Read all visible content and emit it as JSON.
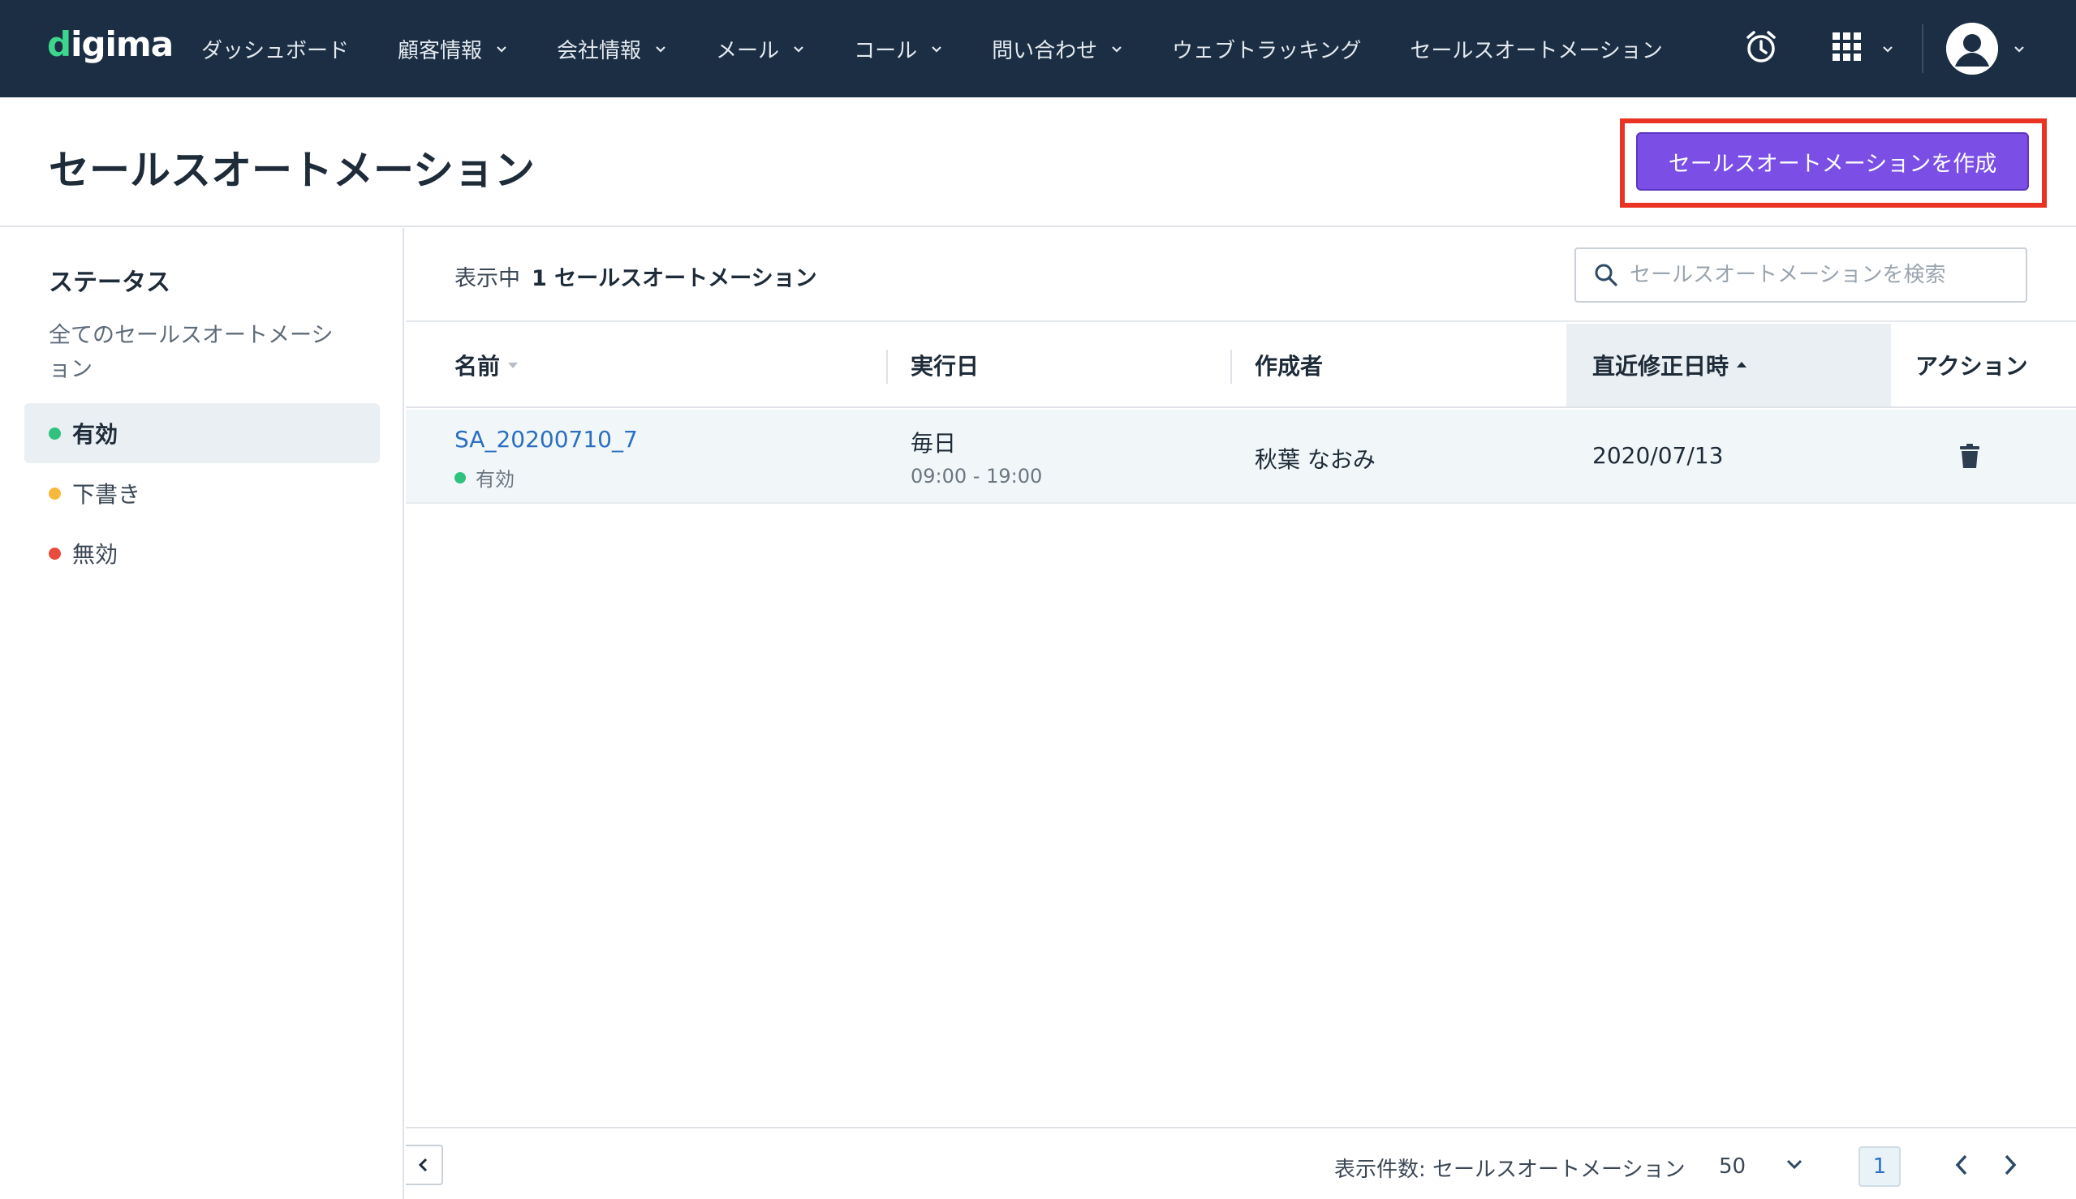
{
  "brand": {
    "logo_text": "igima",
    "logo_mark": "d"
  },
  "nav": {
    "items": [
      {
        "label": "ダッシュボード",
        "has_dropdown": false
      },
      {
        "label": "顧客情報",
        "has_dropdown": true
      },
      {
        "label": "会社情報",
        "has_dropdown": true
      },
      {
        "label": "メール",
        "has_dropdown": true
      },
      {
        "label": "コール",
        "has_dropdown": true
      },
      {
        "label": "問い合わせ",
        "has_dropdown": true
      },
      {
        "label": "ウェブトラッキング",
        "has_dropdown": false
      },
      {
        "label": "セールスオートメーション",
        "has_dropdown": false
      }
    ],
    "icons": [
      "alarm-clock-icon",
      "apps-grid-icon",
      "user-avatar-icon"
    ]
  },
  "page": {
    "title": "セールスオートメーション",
    "create_button": "セールスオートメーションを作成"
  },
  "sidebar": {
    "title": "ステータス",
    "all_label": "全てのセールスオートメーション",
    "items": [
      {
        "label": "有効",
        "color": "#2ec27e",
        "active": true
      },
      {
        "label": "下書き",
        "color": "#f6b93b",
        "active": false
      },
      {
        "label": "無効",
        "color": "#e74c3c",
        "active": false
      }
    ]
  },
  "main": {
    "count_prefix": "表示中",
    "count_text": "1 セールスオートメーション",
    "search_placeholder": "セールスオートメーションを検索",
    "columns": {
      "name": "名前",
      "exec": "実行日",
      "author": "作成者",
      "modified": "直近修正日時",
      "action": "アクション"
    },
    "rows": [
      {
        "name": "SA_20200710_7",
        "status": "有効",
        "status_color": "#2ec27e",
        "exec_day": "毎日",
        "exec_time": "09:00 - 19:00",
        "author": "秋葉 なおみ",
        "modified": "2020/07/13"
      }
    ]
  },
  "footer": {
    "per_page_label": "表示件数: セールスオートメーション",
    "per_page_value": "50",
    "current_page": "1"
  },
  "colors": {
    "navbar": "#1b2e44",
    "accent": "#7b4fe6",
    "highlight": "#ea3323",
    "link": "#2c6fc2"
  }
}
